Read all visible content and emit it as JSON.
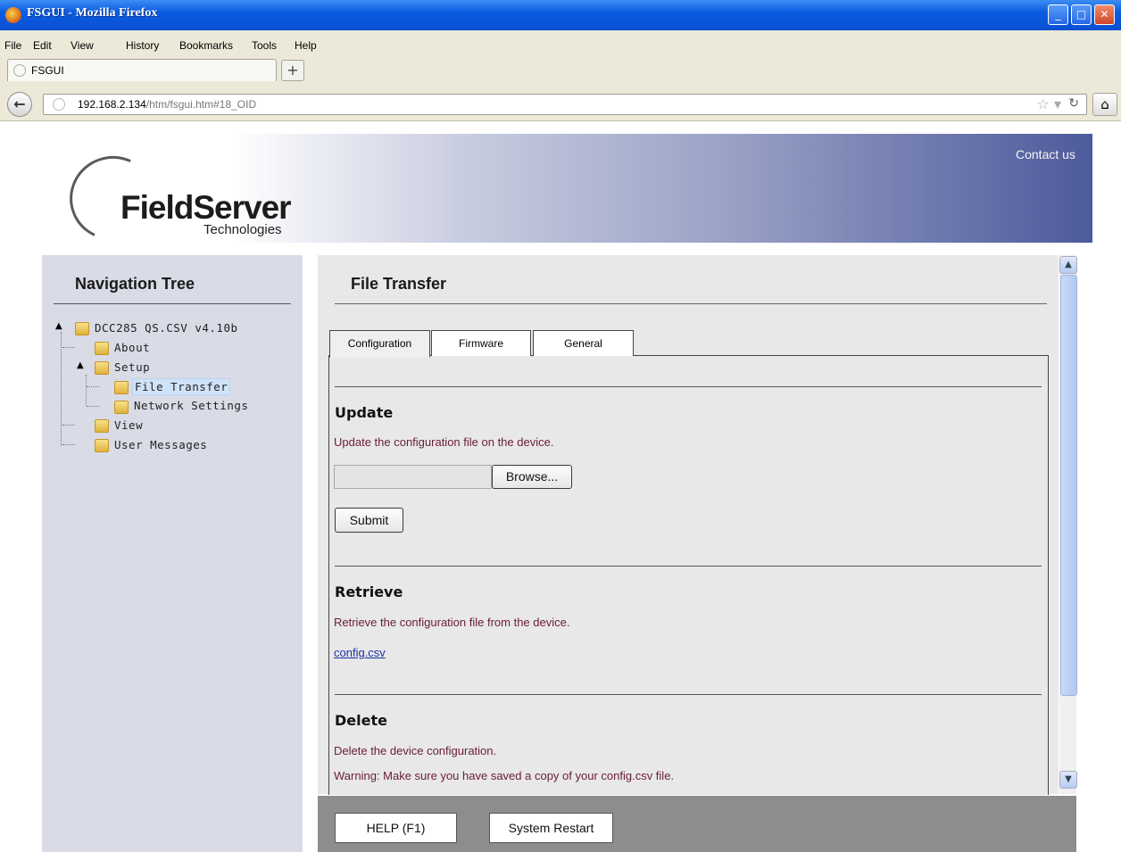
{
  "window": {
    "title": "FSGUI - Mozilla Firefox"
  },
  "menu": {
    "items": [
      "File",
      "Edit",
      "View",
      "History",
      "Bookmarks",
      "Tools",
      "Help"
    ]
  },
  "browser": {
    "tab_title": "FSGUI",
    "new_tab": "+",
    "url_host": "192.168.2.134",
    "url_path": "/htm/fsgui.htm#18_OID"
  },
  "header": {
    "logo_main": "FieldServer",
    "logo_sub": "Technologies",
    "contact": "Contact us"
  },
  "nav": {
    "title": "Navigation Tree",
    "root": "DCC285 QS.CSV v4.10b",
    "items": [
      "About",
      "Setup",
      "File Transfer",
      "Network Settings",
      "View",
      "User Messages"
    ],
    "selected": "File Transfer"
  },
  "content": {
    "title": "File Transfer",
    "tabs": [
      "Configuration",
      "Firmware",
      "General"
    ],
    "active_tab": "Configuration",
    "update": {
      "title": "Update",
      "desc": "Update the configuration file on the device.",
      "browse": "Browse...",
      "submit": "Submit"
    },
    "retrieve": {
      "title": "Retrieve",
      "desc": "Retrieve the configuration file from the device.",
      "link": "config.csv"
    },
    "delete": {
      "title": "Delete",
      "desc": "Delete the device configuration.",
      "warning": "Warning: Make sure you have saved a copy of your config.csv file."
    }
  },
  "footer": {
    "help": "HELP (F1)",
    "restart": "System Restart"
  },
  "colors": {
    "desc_text": "#6a1b3a",
    "link": "#1a33a8",
    "footer_bg": "#8d8d8d",
    "nav_bg": "#d9dce6"
  }
}
